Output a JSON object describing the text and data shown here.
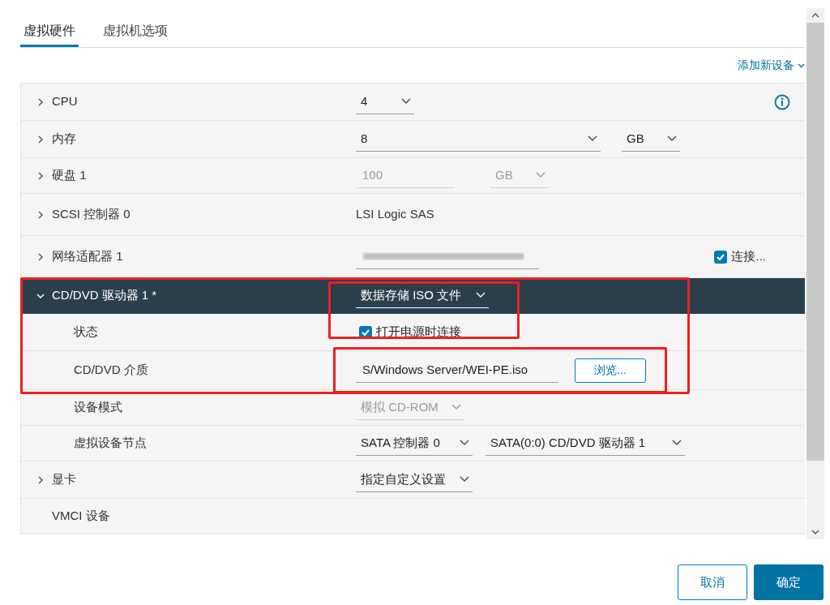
{
  "tabs": [
    {
      "label": "虚拟硬件",
      "selected": true
    },
    {
      "label": "虚拟机选项",
      "selected": false
    }
  ],
  "add_device": "添加新设备",
  "rows": [
    {
      "label": "CPU",
      "expanded": false,
      "info": true,
      "controls": [
        {
          "kind": "select",
          "value": "4",
          "disabled": false
        }
      ]
    },
    {
      "label": "内存",
      "expanded": false,
      "controls": [
        {
          "kind": "select",
          "value": "8",
          "disabled": false
        },
        {
          "kind": "select",
          "value": "GB",
          "disabled": false
        }
      ]
    },
    {
      "label": "硬盘 1",
      "expanded": false,
      "controls": [
        {
          "kind": "input",
          "value": "100",
          "disabled": true
        },
        {
          "kind": "select",
          "value": "GB",
          "disabled": true
        }
      ]
    },
    {
      "label": "SCSI 控制器 0",
      "expanded": false,
      "controls": [
        {
          "kind": "text",
          "value": "LSI Logic SAS"
        }
      ]
    },
    {
      "label": "网络适配器 1",
      "expanded": false,
      "controls": [
        {
          "kind": "blurred"
        }
      ],
      "extra": {
        "label": "连接...",
        "checked": true
      }
    },
    {
      "label": "CD/DVD 驱动器 1 *",
      "expanded": true,
      "selected": true,
      "controls": [
        {
          "kind": "select",
          "value": "数据存储 ISO 文件",
          "disabled": false
        }
      ],
      "children": [
        {
          "label": "状态",
          "controls": [
            {
              "kind": "checkbox",
              "value": "打开电源时连接",
              "checked": true
            }
          ]
        },
        {
          "label": "CD/DVD 介质",
          "controls": [
            {
              "kind": "input",
              "value": "S/Windows Server/WEI-PE.iso",
              "disabled": false
            },
            {
              "kind": "button",
              "value": "浏览..."
            }
          ]
        },
        {
          "label": "设备模式",
          "controls": [
            {
              "kind": "select",
              "value": "模拟 CD-ROM",
              "disabled": true
            }
          ]
        },
        {
          "label": "虚拟设备节点",
          "controls": [
            {
              "kind": "select",
              "value": "SATA 控制器 0",
              "disabled": false
            },
            {
              "kind": "select",
              "value": "SATA(0:0) CD/DVD 驱动器 1",
              "disabled": false
            }
          ]
        }
      ]
    },
    {
      "label": "显卡",
      "expanded": false,
      "controls": [
        {
          "kind": "select",
          "value": "指定自定义设置",
          "disabled": false
        }
      ]
    },
    {
      "label": "VMCI 设备",
      "controls": []
    }
  ],
  "annotation_boxes": [
    {
      "color": "#e8231f"
    },
    {
      "color": "#e8231f"
    },
    {
      "color": "#e8231f"
    }
  ],
  "buttons": [
    {
      "label": "取消",
      "kind": "secondary"
    },
    {
      "label": "确定",
      "kind": "primary"
    }
  ]
}
